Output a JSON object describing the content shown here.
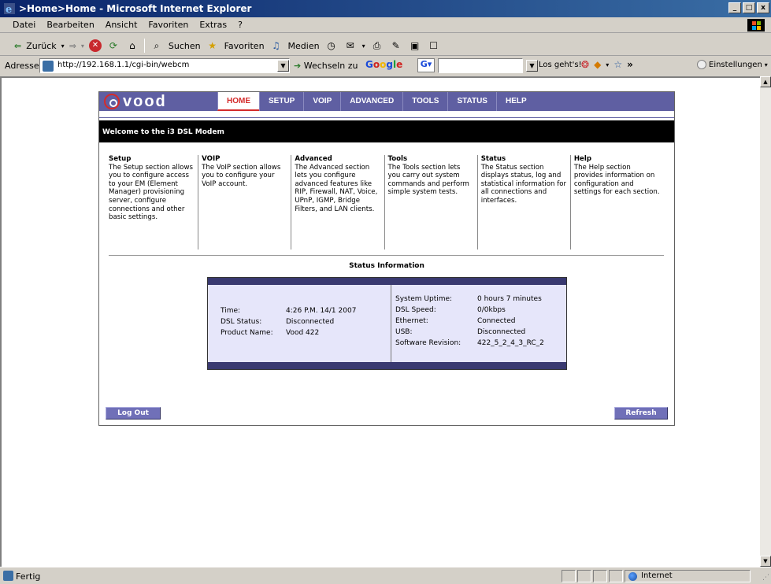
{
  "window": {
    "title": ">Home>Home - Microsoft Internet Explorer",
    "buttons": {
      "minimize": "_",
      "maximize": "□",
      "close": "x"
    }
  },
  "menubar": {
    "items": [
      "Datei",
      "Bearbeiten",
      "Ansicht",
      "Favoriten",
      "Extras",
      "?"
    ]
  },
  "toolbar": {
    "back_label": "Zurück",
    "search_label": "Suchen",
    "favorites_label": "Favoriten",
    "media_label": "Medien"
  },
  "addressbar": {
    "label": "Adresse",
    "url": "http://192.168.1.1/cgi-bin/webcm",
    "go_label": "Wechseln zu",
    "google_search_label": "Los geht's!",
    "settings_label": "Einstellungen"
  },
  "router": {
    "logo_text": "vood",
    "tabs": [
      "HOME",
      "SETUP",
      "VOIP",
      "ADVANCED",
      "TOOLS",
      "STATUS",
      "HELP"
    ],
    "active_tab": "HOME",
    "welcome": "Welcome to the i3 DSL Modem",
    "sections": [
      {
        "title": "Setup",
        "text": "The Setup section allows you to configure access to your EM (Element Manager) provisioning server, configure connections and other basic settings."
      },
      {
        "title": "VOIP",
        "text": "The VoIP section allows you to configure your VoIP account."
      },
      {
        "title": "Advanced",
        "text": "The Advanced section lets you configure advanced features like RIP, Firewall, NAT, Voice, UPnP, IGMP, Bridge Filters, and LAN clients."
      },
      {
        "title": "Tools",
        "text": "The Tools section lets you carry out system commands and perform simple system tests."
      },
      {
        "title": "Status",
        "text": "The Status section displays status, log and statistical information for all connections and interfaces."
      },
      {
        "title": "Help",
        "text": "The Help section provides information on configuration and settings for each section."
      }
    ],
    "status_title": "Status Information",
    "status_left": {
      "time_label": "Time:",
      "time_value": "4:26 P.M. 14/1 2007",
      "dsl_label": "DSL Status:",
      "dsl_value": "Disconnected",
      "product_label": "Product Name:",
      "product_value": "Vood 422"
    },
    "status_right": {
      "uptime_label": "System Uptime:",
      "uptime_value": "0 hours 7 minutes",
      "speed_label": "DSL Speed:",
      "speed_value": "0/0kbps",
      "ethernet_label": "Ethernet:",
      "ethernet_value": "Connected",
      "usb_label": "USB:",
      "usb_value": "Disconnected",
      "sw_label": "Software Revision:",
      "sw_value": "422_5_2_4_3_RC_2"
    },
    "logout_label": "Log Out",
    "refresh_label": "Refresh"
  },
  "statusbar": {
    "text": "Fertig",
    "zone": "Internet"
  },
  "colors": {
    "nav_bg": "#5f5fa2",
    "active_tab": "#d42b2b",
    "status_box": "#e6e6fa"
  }
}
